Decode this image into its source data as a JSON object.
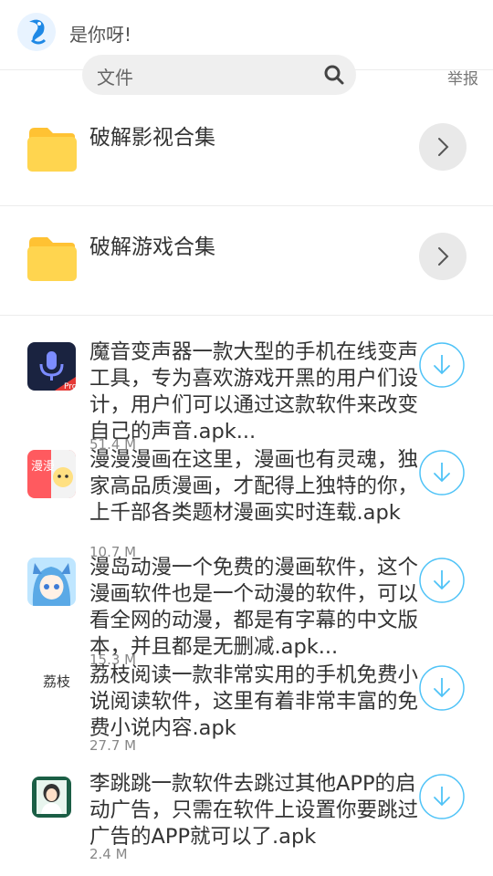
{
  "header": {
    "greeting": "是你呀!",
    "search_placeholder": "文件",
    "report_label": "举报"
  },
  "folders": [
    {
      "title": "破解影视合集"
    },
    {
      "title": "破解游戏合集"
    }
  ],
  "apps": [
    {
      "description": "魔音变声器一款大型的手机在线变声工具，专为喜欢游戏开黑的用户们设计，用户们可以通过这款软件来改变自己的声音.apk...",
      "size": "51.4 M",
      "icon_label": "Pro"
    },
    {
      "description": "漫漫漫画在这里，漫画也有灵魂，独家高品质漫画，才配得上独特的你，上千部各类题材漫画实时连载.apk",
      "size": "10.7 M",
      "icon_label": "漫漫"
    },
    {
      "description": "漫岛动漫一个免费的漫画软件，这个漫画软件也是一个动漫的软件，可以看全网的动漫，都是有字幕的中文版本，并且都是无删减.apk...",
      "size": "15.3 M"
    },
    {
      "description": "荔枝阅读一款非常实用的手机免费小说阅读软件，这里有着非常丰富的免费小说内容.apk",
      "size": "27.7 M",
      "icon_label": "荔枝"
    },
    {
      "description": "李跳跳一款软件去跳过其他APP的启动广告，只需在软件上设置你要跳过广告的APP就可以了.apk",
      "size": "2.4 M"
    }
  ],
  "colors": {
    "folder": "#ffd54f",
    "folder_tab": "#ffc233",
    "download_ring": "#4fc3f7"
  }
}
